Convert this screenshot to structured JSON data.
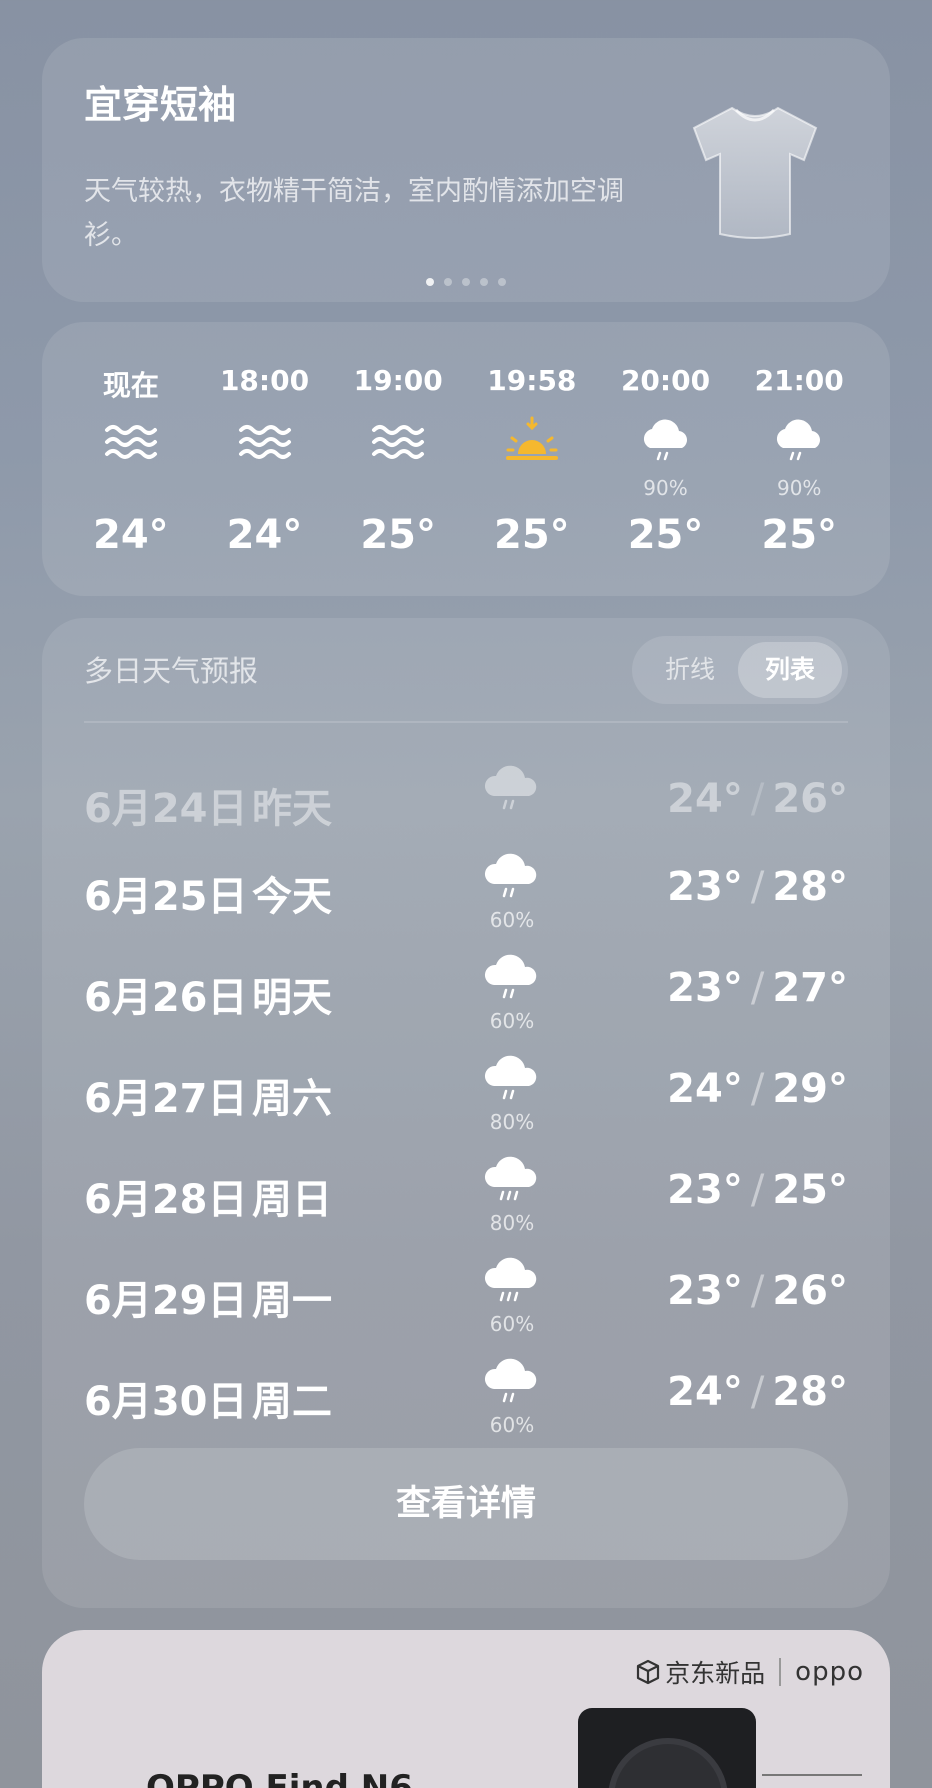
{
  "clothing": {
    "title": "宜穿短袖",
    "description": "天气较热，衣物精干简洁，室内酌情添加空调衫。",
    "pages": 5,
    "active_page": 1,
    "icon": "tshirt-icon"
  },
  "hourly": [
    {
      "time": "现在",
      "icon": "haze-icon",
      "pop": "",
      "temp": "24°"
    },
    {
      "time": "18:00",
      "icon": "haze-icon",
      "pop": "",
      "temp": "24°"
    },
    {
      "time": "19:00",
      "icon": "haze-icon",
      "pop": "",
      "temp": "25°"
    },
    {
      "time": "19:58",
      "icon": "sunset-icon",
      "pop": "",
      "temp": "25°"
    },
    {
      "time": "20:00",
      "icon": "rain-cloud-icon",
      "pop": "90%",
      "temp": "25°"
    },
    {
      "time": "21:00",
      "icon": "rain-cloud-icon",
      "pop": "90%",
      "temp": "25°"
    }
  ],
  "forecast": {
    "title": "多日天气预报",
    "toggle": {
      "line": "折线",
      "list": "列表",
      "selected": "列表"
    },
    "days": [
      {
        "date": "6月24日",
        "weekday": "昨天",
        "pop": "",
        "low": "24°",
        "high": "26°",
        "past": true
      },
      {
        "date": "6月25日",
        "weekday": "今天",
        "pop": "60%",
        "low": "23°",
        "high": "28°",
        "past": false
      },
      {
        "date": "6月26日",
        "weekday": "明天",
        "pop": "60%",
        "low": "23°",
        "high": "27°",
        "past": false
      },
      {
        "date": "6月27日",
        "weekday": "周六",
        "pop": "80%",
        "low": "24°",
        "high": "29°",
        "past": false
      },
      {
        "date": "6月28日",
        "weekday": "周日",
        "pop": "80%",
        "low": "23°",
        "high": "25°",
        "past": false
      },
      {
        "date": "6月29日",
        "weekday": "周一",
        "pop": "60%",
        "low": "23°",
        "high": "26°",
        "past": false
      },
      {
        "date": "6月30日",
        "weekday": "周二",
        "pop": "60%",
        "low": "24°",
        "high": "28°",
        "past": false
      }
    ],
    "separator": "/",
    "detail_button": "查看详情"
  },
  "ad": {
    "channel": "京东新品",
    "brand": "oppo",
    "product": "OPPO Find N6"
  },
  "colors": {
    "sun": "#f5b82e",
    "card_bg": "rgba(255,255,255,0.10)"
  }
}
